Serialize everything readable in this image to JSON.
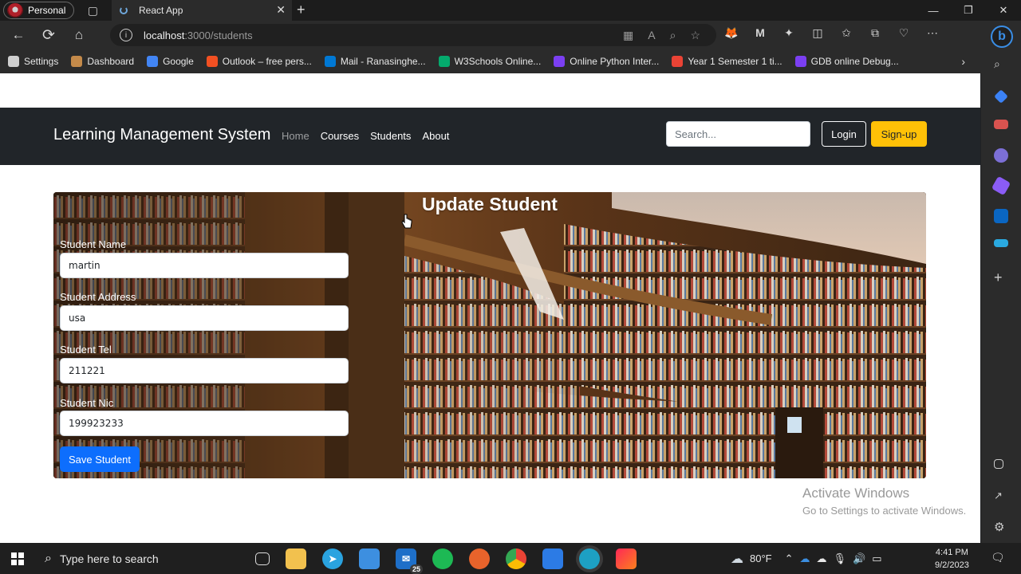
{
  "browser": {
    "profile_label": "Personal",
    "tab_title": "React App",
    "url_host": "localhost",
    "url_path": ":3000/students",
    "bookmarks": [
      {
        "label": "Settings",
        "color": "#cfcfcf"
      },
      {
        "label": "Dashboard",
        "color": "#c48a4a"
      },
      {
        "label": "Google",
        "color": "#4285f4"
      },
      {
        "label": "Outlook – free pers...",
        "color": "#f25022"
      },
      {
        "label": "Mail - Ranasinghe...",
        "color": "#0078d4"
      },
      {
        "label": "W3Schools Online...",
        "color": "#04aa6d"
      },
      {
        "label": "Online Python Inter...",
        "color": "#7b3ff2"
      },
      {
        "label": "Year 1 Semester 1 ti...",
        "color": "#ea4335"
      },
      {
        "label": "GDB online Debug...",
        "color": "#7b3ff2"
      }
    ]
  },
  "navbar": {
    "brand": "Learning Management System",
    "links": [
      "Home",
      "Courses",
      "Students",
      "About"
    ],
    "search_placeholder": "Search...",
    "login_label": "Login",
    "signup_label": "Sign-up"
  },
  "form": {
    "title": "Update Student",
    "fields": [
      {
        "label": "Student Name",
        "value": "martin"
      },
      {
        "label": "Student Address",
        "value": "usa"
      },
      {
        "label": "Student Tel",
        "value": "211221"
      },
      {
        "label": "Student Nic",
        "value": "199923233"
      }
    ],
    "save_label": "Save Student"
  },
  "watermark": {
    "line1": "Activate Windows",
    "line2": "Go to Settings to activate Windows."
  },
  "taskbar": {
    "search_placeholder": "Type here to search",
    "mail_badge": "25",
    "temperature": "80°F",
    "time": "4:41 PM",
    "date": "9/2/2023"
  },
  "colors": {
    "navbar_bg": "#212529",
    "signup_bg": "#ffc107",
    "save_bg": "#0d6efd"
  }
}
